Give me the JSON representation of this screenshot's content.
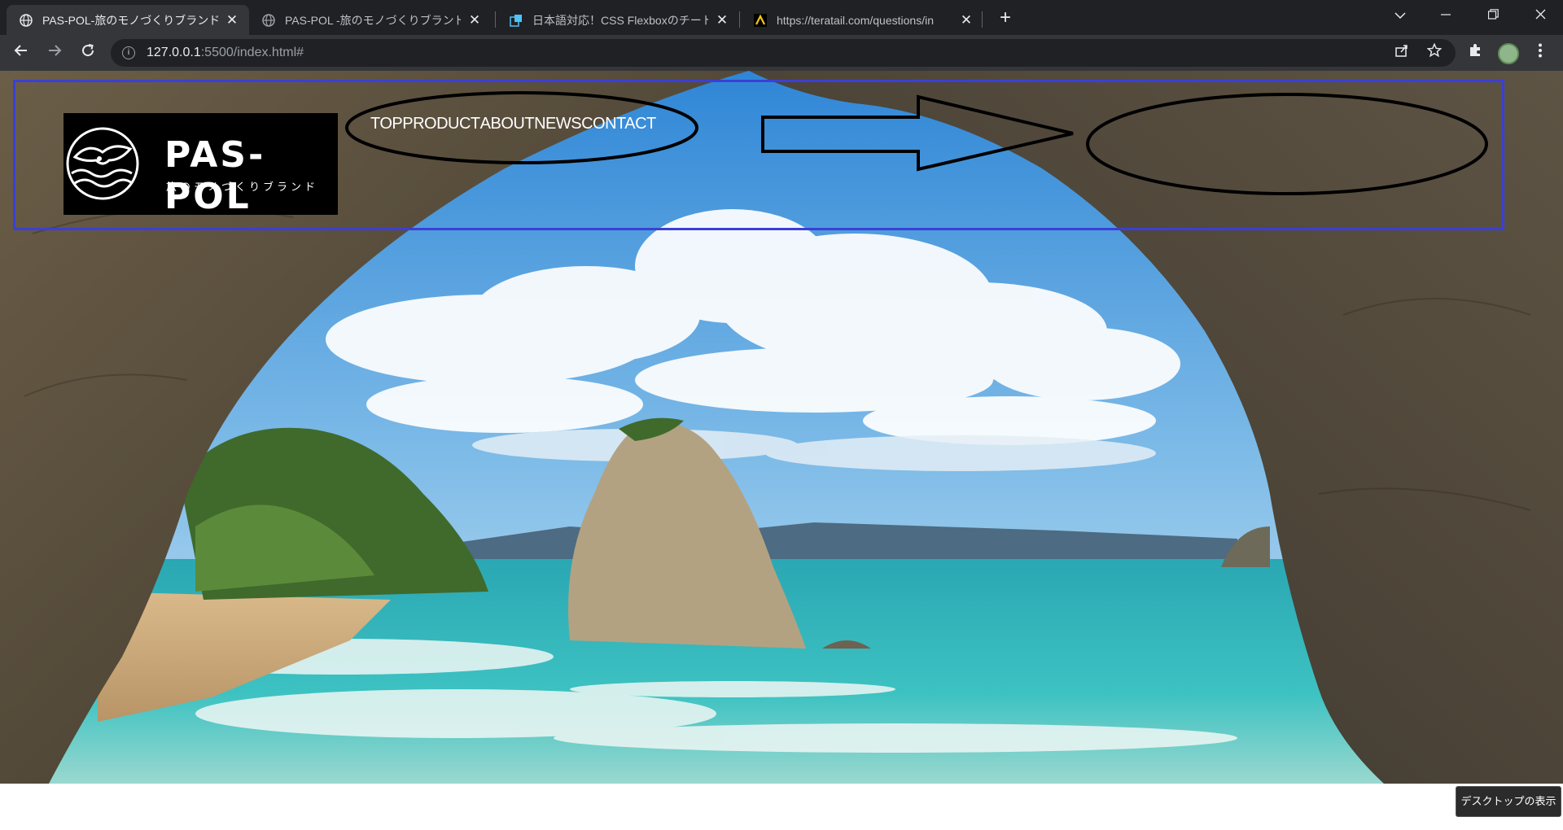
{
  "browser": {
    "tabs": [
      {
        "title": "PAS-POL-旅のモノづくりブランド-|TAIL",
        "active": true,
        "favicon": "globe-icon"
      },
      {
        "title": "PAS-POL -旅のモノづくりブランド- | TA",
        "active": false,
        "favicon": "globe-icon"
      },
      {
        "title": "日本語対応！CSS Flexboxのチートシー",
        "active": false,
        "favicon": "flexbox-icon"
      },
      {
        "title": "https://teratail.com/questions/in",
        "active": false,
        "favicon": "teratail-icon"
      }
    ],
    "close_glyph": "✕",
    "new_tab_glyph": "+",
    "address": {
      "host": "127.0.0.1",
      "path": ":5500/index.html#"
    }
  },
  "page": {
    "logo": {
      "brand": "PAS-POL",
      "tagline": "旅のモノづくりブランド"
    },
    "nav": [
      "TOP",
      "PRODUCT",
      "ABOUT",
      "NEWS",
      "CONTACT"
    ]
  },
  "os": {
    "show_desktop_tooltip": "デスクトップの表示"
  },
  "colors": {
    "header_outline": "#3b3fd6",
    "annotation_stroke": "#000000"
  }
}
